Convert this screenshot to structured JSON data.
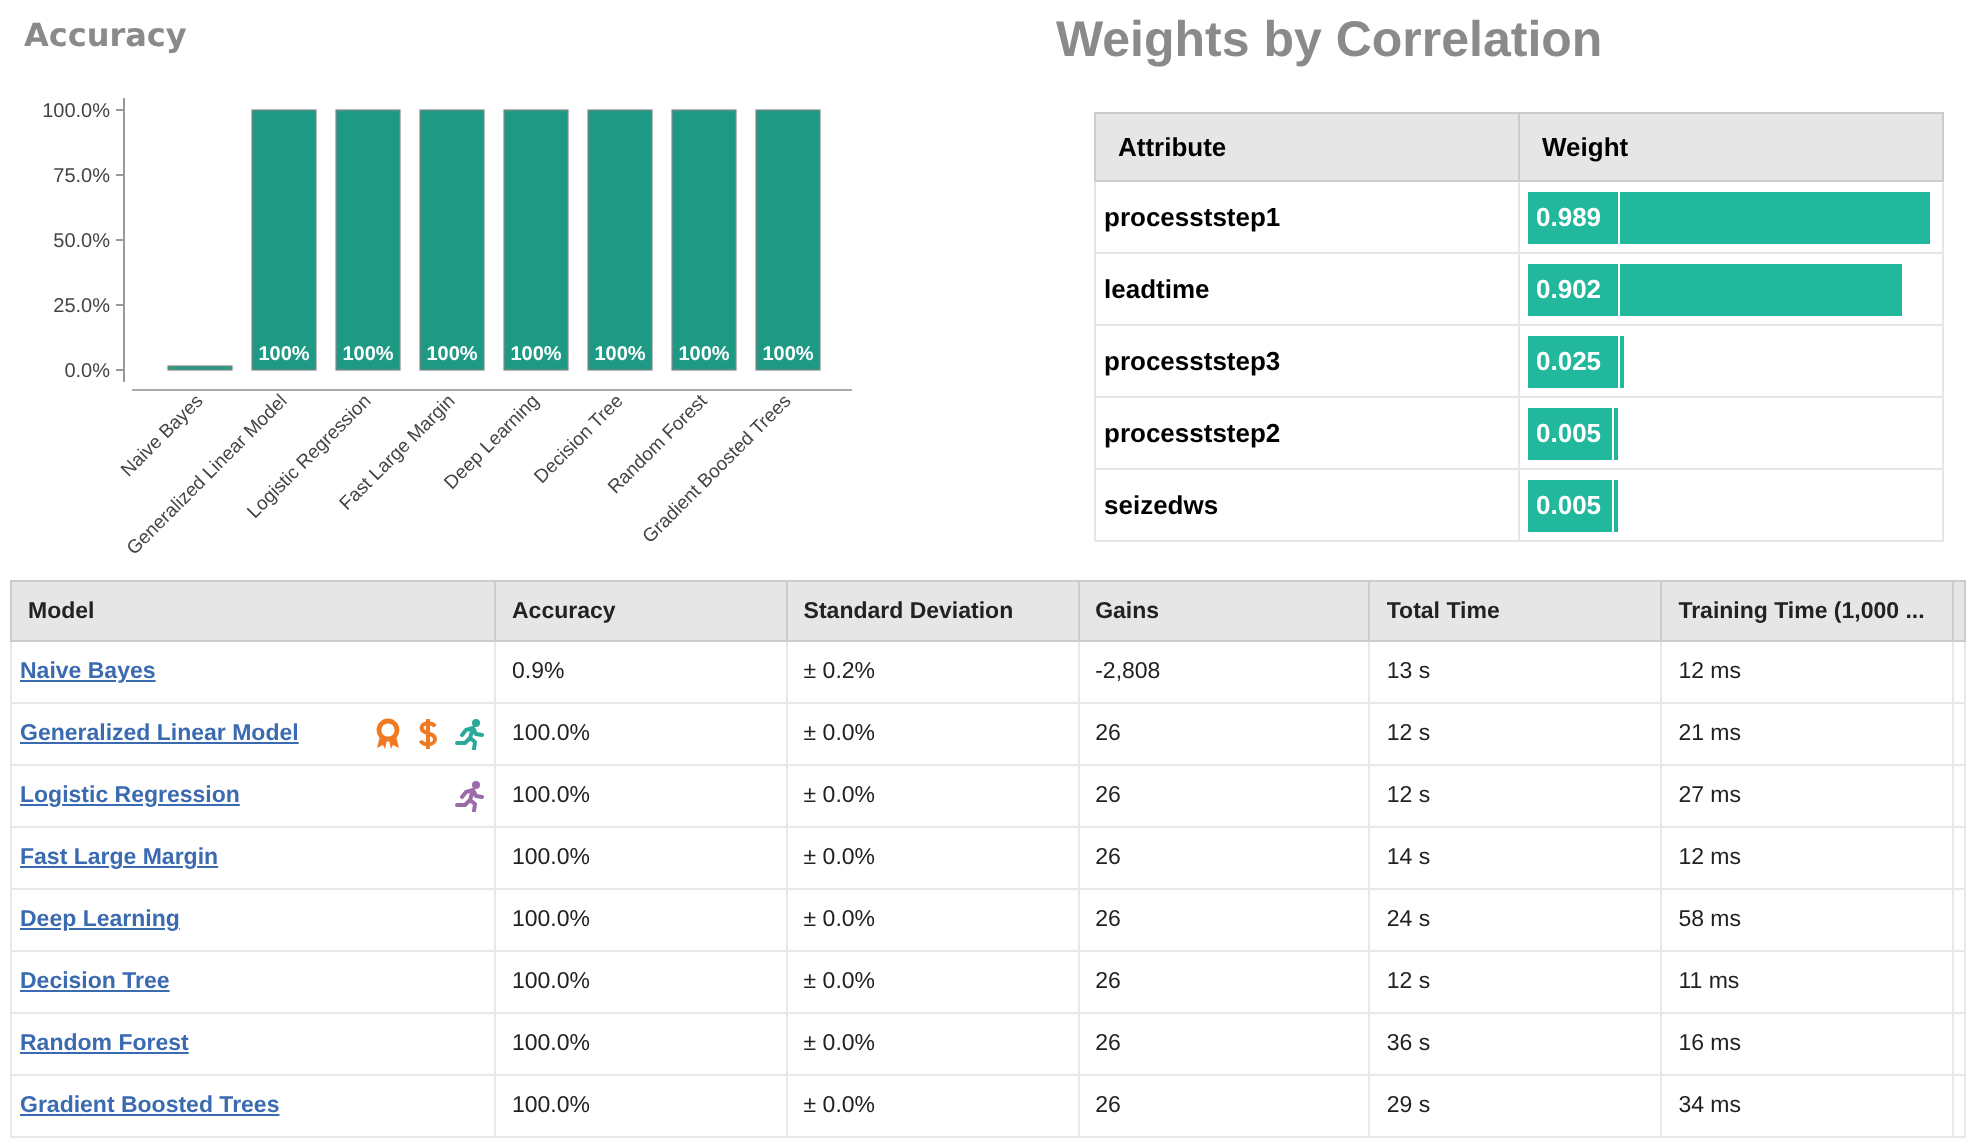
{
  "accuracy_chart": {
    "title": "Accuracy",
    "chart_data": {
      "type": "bar",
      "categories": [
        "Naive Bayes",
        "Generalized Linear Model",
        "Logistic Regression",
        "Fast Large Margin",
        "Deep Learning",
        "Decision Tree",
        "Random Forest",
        "Gradient Boosted Trees"
      ],
      "values": [
        0.9,
        100,
        100,
        100,
        100,
        100,
        100,
        100
      ],
      "ylim": [
        0,
        100
      ],
      "yticks": [
        {
          "value": 0,
          "label": "0.0%"
        },
        {
          "value": 25,
          "label": "25.0%"
        },
        {
          "value": 50,
          "label": "50.0%"
        },
        {
          "value": 75,
          "label": "75.0%"
        },
        {
          "value": 100,
          "label": "100.0%"
        }
      ],
      "value_labels": [
        null,
        "100%",
        "100%",
        "100%",
        "100%",
        "100%",
        "100%",
        "100%"
      ]
    }
  },
  "weights": {
    "title": "Weights by Correlation",
    "columns": [
      "Attribute",
      "Weight"
    ],
    "rows": [
      {
        "attribute": "procesststep1",
        "weight": "0.989"
      },
      {
        "attribute": "leadtime",
        "weight": "0.902"
      },
      {
        "attribute": "procesststep3",
        "weight": "0.025"
      },
      {
        "attribute": "procesststep2",
        "weight": "0.005"
      },
      {
        "attribute": "seizedws",
        "weight": "0.005"
      }
    ]
  },
  "models_table": {
    "columns": [
      "Model",
      "Accuracy",
      "Standard Deviation",
      "Gains",
      "Total Time",
      "Training Time (1,000 ..."
    ],
    "rows": [
      {
        "icons": [],
        "cells": [
          "Naive Bayes",
          "0.9%",
          "± 0.2%",
          "-2,808",
          "13 s",
          "12 ms"
        ]
      },
      {
        "icons": [
          {
            "kind": "award"
          },
          {
            "kind": "dollar"
          },
          {
            "kind": "runner",
            "color": "#2aa89a"
          }
        ],
        "cells": [
          "Generalized Linear Model",
          "100.0%",
          "± 0.0%",
          "26",
          "12 s",
          "21 ms"
        ]
      },
      {
        "icons": [
          {
            "kind": "runner",
            "color": "#9b6aa8"
          }
        ],
        "cells": [
          "Logistic Regression",
          "100.0%",
          "± 0.0%",
          "26",
          "12 s",
          "27 ms"
        ]
      },
      {
        "icons": [],
        "cells": [
          "Fast Large Margin",
          "100.0%",
          "± 0.0%",
          "26",
          "14 s",
          "12 ms"
        ]
      },
      {
        "icons": [],
        "cells": [
          "Deep Learning",
          "100.0%",
          "± 0.0%",
          "26",
          "24 s",
          "58 ms"
        ]
      },
      {
        "icons": [],
        "cells": [
          "Decision Tree",
          "100.0%",
          "± 0.0%",
          "26",
          "12 s",
          "11 ms"
        ]
      },
      {
        "icons": [],
        "cells": [
          "Random Forest",
          "100.0%",
          "± 0.0%",
          "26",
          "36 s",
          "16 ms"
        ]
      },
      {
        "icons": [],
        "cells": [
          "Gradient Boosted Trees",
          "100.0%",
          "± 0.0%",
          "26",
          "29 s",
          "34 ms"
        ]
      }
    ]
  }
}
